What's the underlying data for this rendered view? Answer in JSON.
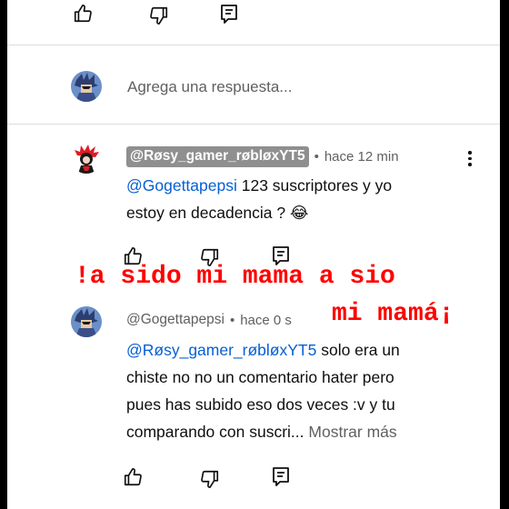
{
  "reply_input": {
    "placeholder": "Agrega una respuesta..."
  },
  "comment1": {
    "handle": "@Røsy_gamer_røbløxYT5",
    "timestamp": "hace 12 min",
    "separator": "•",
    "mention": "@Gogettapepsi",
    "text_line1": " 123 suscriptores y yo",
    "text_line2": "estoy en decadencia ? 😂"
  },
  "comment2": {
    "handle": "@Gogettapepsi",
    "timestamp": "hace 0 s",
    "separator": "•",
    "mention": "@Røsy_gamer_røbløxYT5",
    "text_line1_rest": " solo era un",
    "text_line2": "chiste no no un comentario hater pero",
    "text_line3": "pues has subido eso dos veces :v y tu",
    "text_line4": "comparando con suscri...",
    "more_label": "Mostrar más"
  },
  "overlay": {
    "line1": "!a sido mi mama a sio",
    "line2": "mi mamá¡"
  },
  "colors": {
    "overlay_red": "#ff0000",
    "link_blue": "#065fd4",
    "handle_chip_bg": "#8f8f8f"
  },
  "icons": [
    "like-icon",
    "dislike-icon",
    "reply-icon",
    "more-vert-icon",
    "avatar"
  ]
}
